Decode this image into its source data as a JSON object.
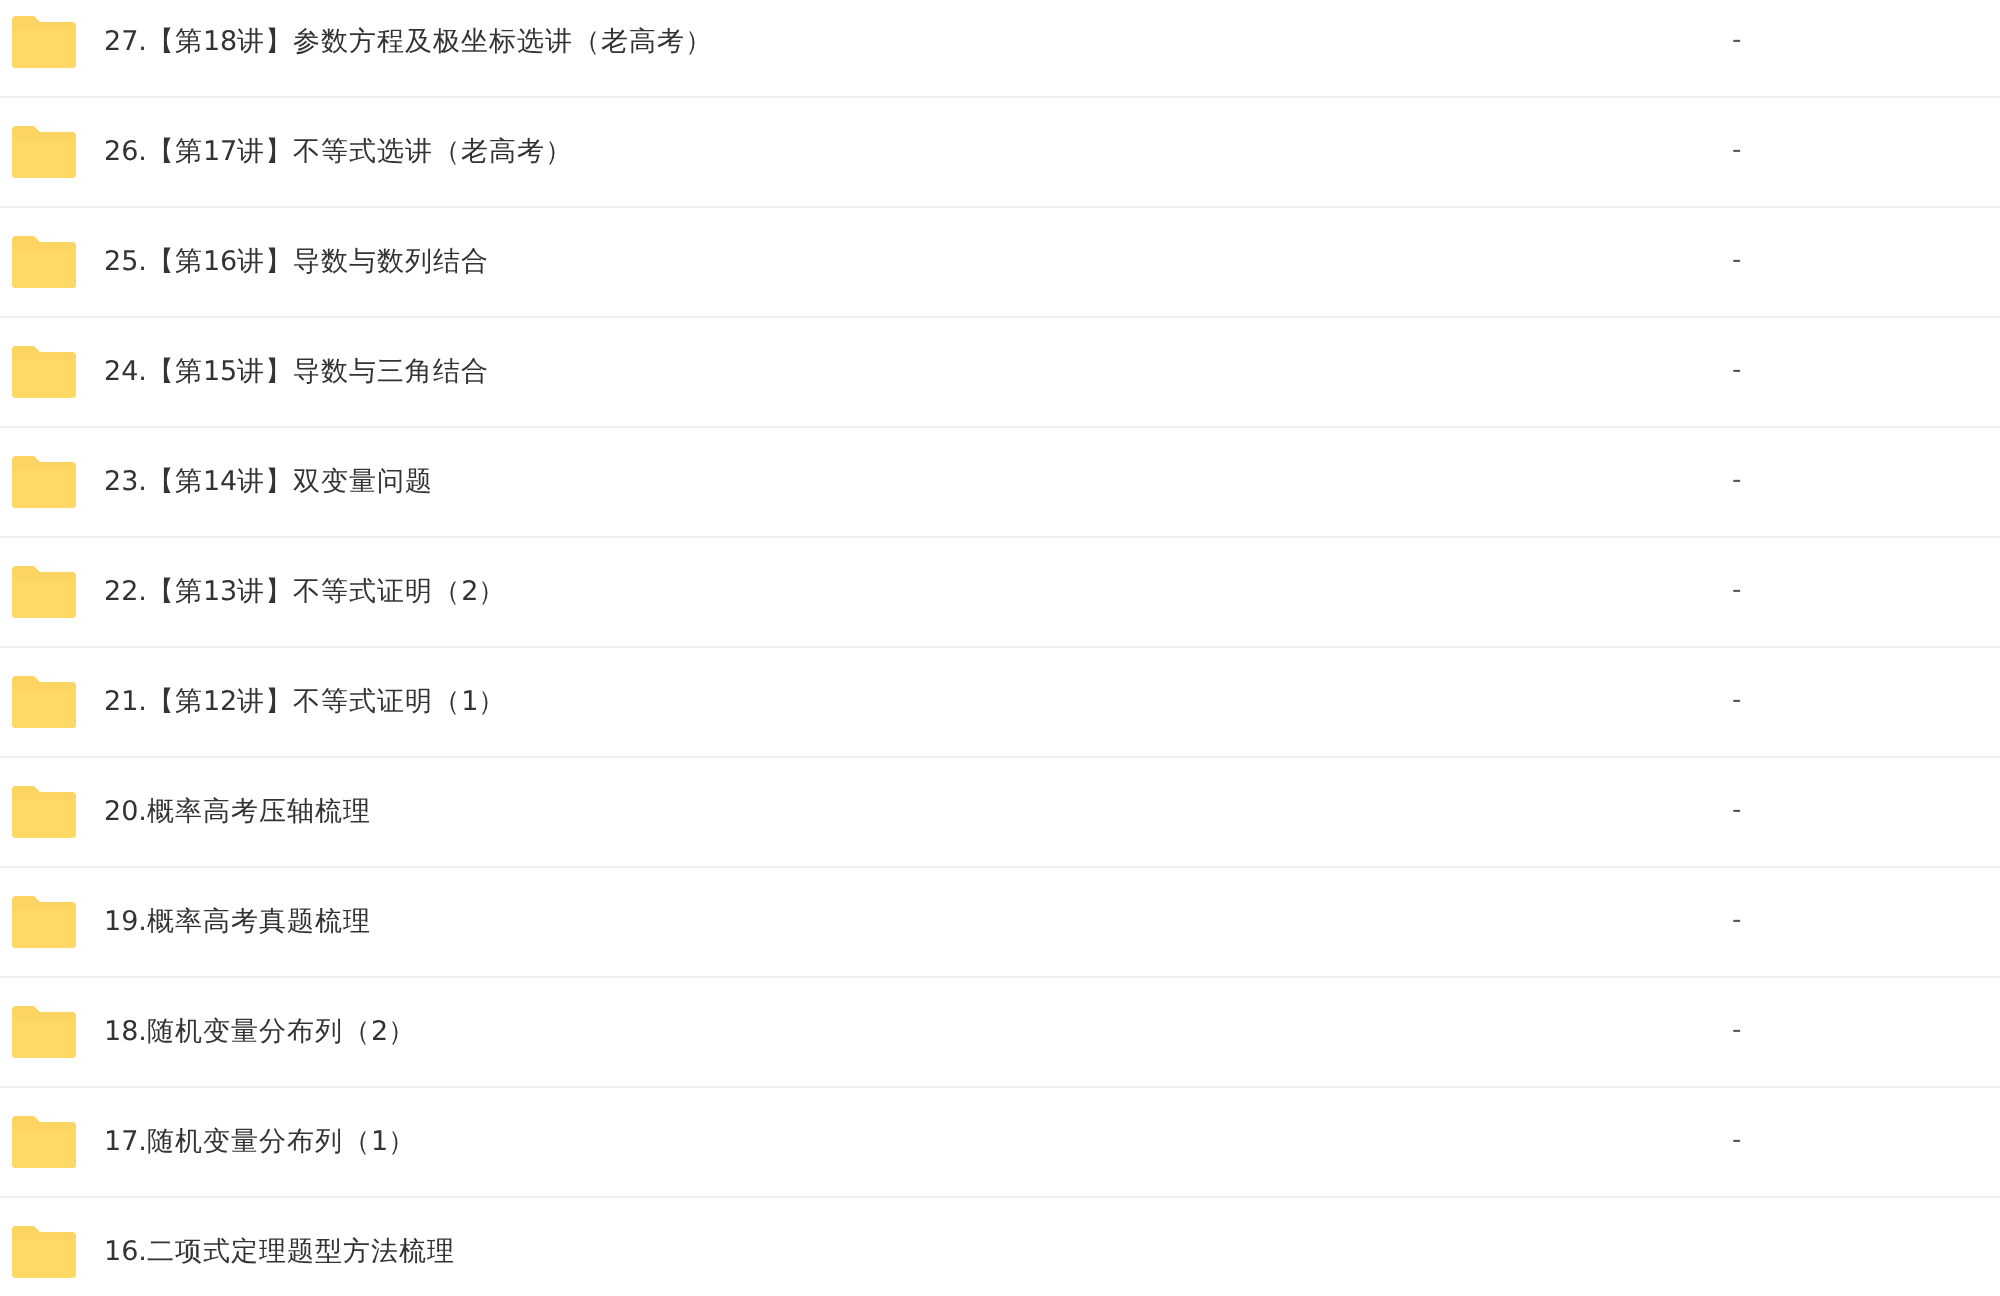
{
  "files": [
    {
      "name": "27.【第18讲】参数方程及极坐标选讲（老高考）",
      "size": "-"
    },
    {
      "name": "26.【第17讲】不等式选讲（老高考）",
      "size": "-"
    },
    {
      "name": "25.【第16讲】导数与数列结合",
      "size": "-"
    },
    {
      "name": "24.【第15讲】导数与三角结合",
      "size": "-"
    },
    {
      "name": "23.【第14讲】双变量问题",
      "size": "-"
    },
    {
      "name": "22.【第13讲】不等式证明（2）",
      "size": "-"
    },
    {
      "name": "21.【第12讲】不等式证明（1）",
      "size": "-"
    },
    {
      "name": "20.概率高考压轴梳理",
      "size": "-"
    },
    {
      "name": "19.概率高考真题梳理",
      "size": "-"
    },
    {
      "name": "18.随机变量分布列（2）",
      "size": "-"
    },
    {
      "name": "17.随机变量分布列（1）",
      "size": "-"
    },
    {
      "name": "16.二项式定理题型方法梳理"
    }
  ]
}
